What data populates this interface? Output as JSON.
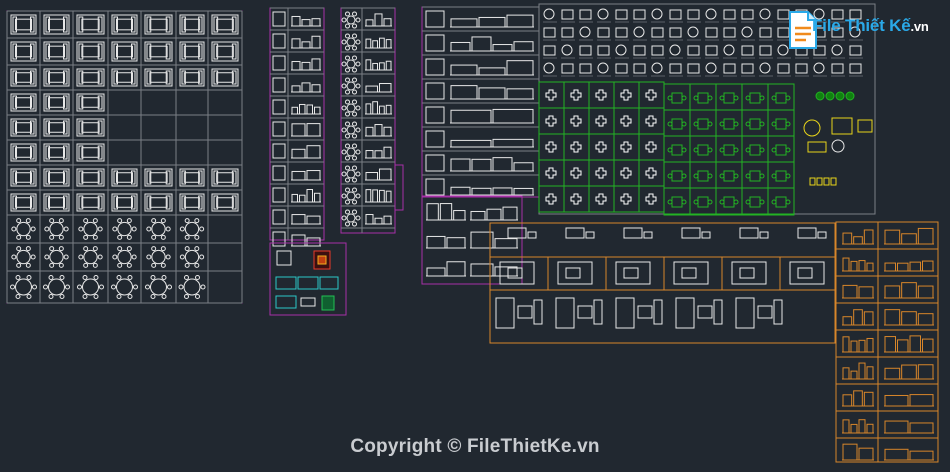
{
  "logo": {
    "brand": "File Thiết Kế",
    "tld": ".vn",
    "icon": "document-icon"
  },
  "watermark": {
    "text": "Copyright © FileThietKe.vn"
  },
  "colors": {
    "background": "#212830",
    "block_frame": "#a82fa8",
    "chair_blocks": "#23b423",
    "sofa_blocks": "#d8862a",
    "cad_line": "#e8e8e8",
    "yellow_table": "#e8d51a",
    "logo_blue": "#2aa9e8"
  }
}
